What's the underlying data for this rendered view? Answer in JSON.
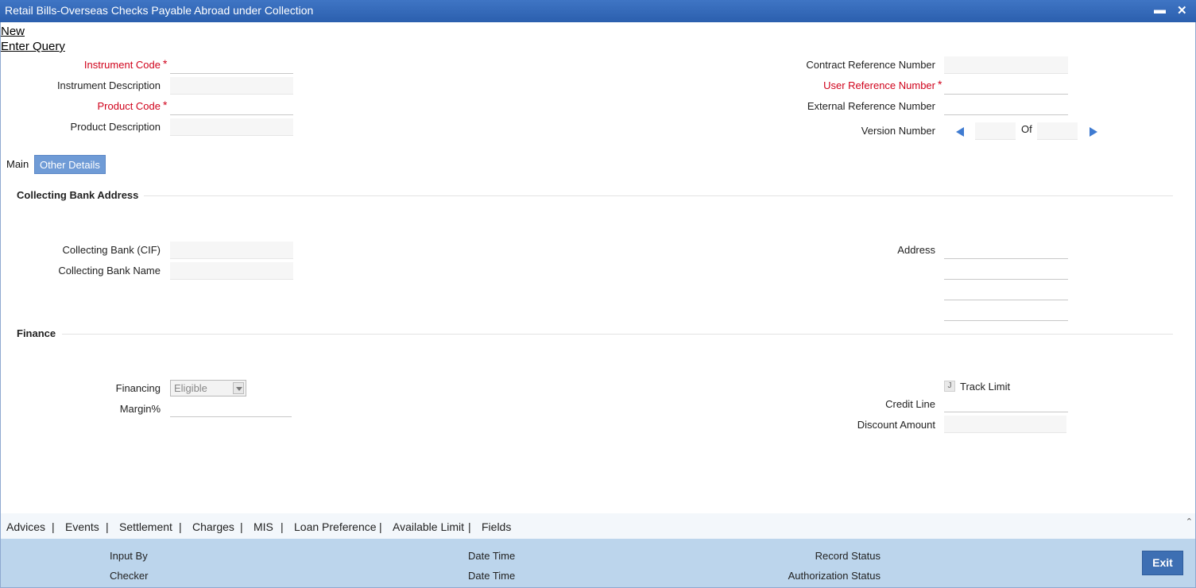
{
  "window": {
    "title": "Retail Bills-Overseas Checks Payable Abroad under Collection",
    "minimize": "▬",
    "close": "✕"
  },
  "menu": {
    "new": "New",
    "enter_query": "Enter Query"
  },
  "header_left": {
    "instrument_code": "Instrument Code",
    "instrument_description": "Instrument Description",
    "product_code": "Product Code",
    "product_description": "Product Description",
    "required_mark": "*"
  },
  "header_right": {
    "contract_reference_number": "Contract Reference Number",
    "user_reference_number": "User Reference Number",
    "external_reference_number": "External Reference Number",
    "version_number": "Version Number",
    "of": "Of"
  },
  "tabs": {
    "main": "Main",
    "other_details": "Other Details"
  },
  "collecting_bank": {
    "section_title": "Collecting Bank Address",
    "cif_label": "Collecting Bank (CIF)",
    "name_label": "Collecting Bank Name",
    "address_label": "Address"
  },
  "finance": {
    "section_title": "Finance",
    "financing_label": "Financing",
    "financing_value": "Eligible",
    "margin_label": "Margin%",
    "track_limit_label": "Track Limit",
    "track_limit_mark": "J",
    "credit_line_label": "Credit Line",
    "discount_amount_label": "Discount Amount"
  },
  "bottom_nav": {
    "items": [
      "Advices",
      "Events",
      "Settlement",
      "Charges",
      "MIS",
      "Loan Preference",
      "Available Limit",
      "Fields"
    ],
    "separator": "|",
    "scroll_up": "⌃"
  },
  "footer": {
    "input_by": "Input By",
    "checker": "Checker",
    "date_time_1": "Date Time",
    "date_time_2": "Date Time",
    "record_status": "Record Status",
    "authorization_status": "Authorization Status",
    "exit": "Exit"
  },
  "colors": {
    "title_bar": "#2b5fae",
    "required": "#d0021b",
    "tab_active_bg": "#6f9bd6",
    "footer_bg": "#bcd5ec",
    "exit_button": "#3d6fb3",
    "arrow": "#3f7bd1"
  }
}
